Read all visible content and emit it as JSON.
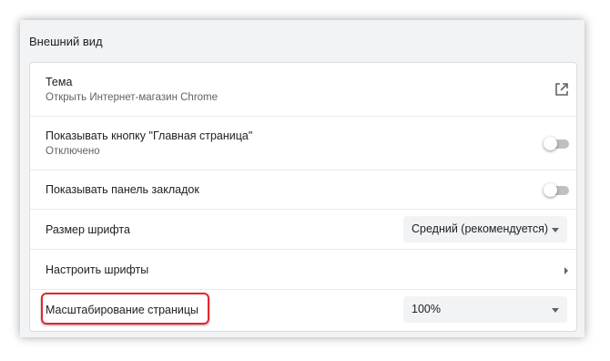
{
  "section": {
    "title": "Внешний вид"
  },
  "rows": {
    "theme": {
      "label": "Тема",
      "sublabel": "Открыть Интернет-магазин Chrome",
      "icon": "open-in-new-icon"
    },
    "home_button": {
      "label": "Показывать кнопку \"Главная страница\"",
      "sublabel": "Отключено",
      "enabled": false
    },
    "bookmarks_bar": {
      "label": "Показывать панель закладок",
      "enabled": false
    },
    "font_size": {
      "label": "Размер шрифта",
      "selected": "Средний (рекомендуется)"
    },
    "customize_fonts": {
      "label": "Настроить шрифты",
      "icon": "chevron-right-icon"
    },
    "page_zoom": {
      "label": "Масштабирование страницы",
      "selected": "100%"
    }
  },
  "colors": {
    "highlight": "#e3262e",
    "toggle_off_track": "#bdc1c6"
  }
}
